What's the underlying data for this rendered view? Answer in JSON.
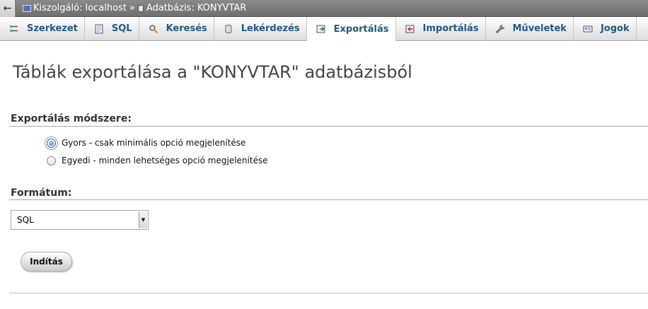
{
  "breadcrumb": {
    "back_glyph": "←",
    "server_label": "Kiszolgáló: localhost",
    "separator": "»",
    "database_label": "Adatbázis: KONYVTAR"
  },
  "tabs": [
    {
      "label": "Szerkezet",
      "icon": "structure-icon"
    },
    {
      "label": "SQL",
      "icon": "sql-icon"
    },
    {
      "label": "Keresés",
      "icon": "search-icon"
    },
    {
      "label": "Lekérdezés",
      "icon": "query-icon"
    },
    {
      "label": "Exportálás",
      "icon": "export-icon",
      "active": true
    },
    {
      "label": "Importálás",
      "icon": "import-icon"
    },
    {
      "label": "Műveletek",
      "icon": "operations-icon"
    },
    {
      "label": "Jogok",
      "icon": "privileges-icon"
    }
  ],
  "page": {
    "title": "Táblák exportálása a \"KONYVTAR\" adatbázisból"
  },
  "export_method": {
    "heading": "Exportálás módszere:",
    "options": [
      {
        "label": "Gyors - csak minimális opció megjelenítése",
        "checked": true
      },
      {
        "label": "Egyedi - minden lehetséges opció megjelenítése",
        "checked": false
      }
    ]
  },
  "format": {
    "heading": "Formátum:",
    "selected": "SQL"
  },
  "submit": {
    "label": "Indítás"
  }
}
